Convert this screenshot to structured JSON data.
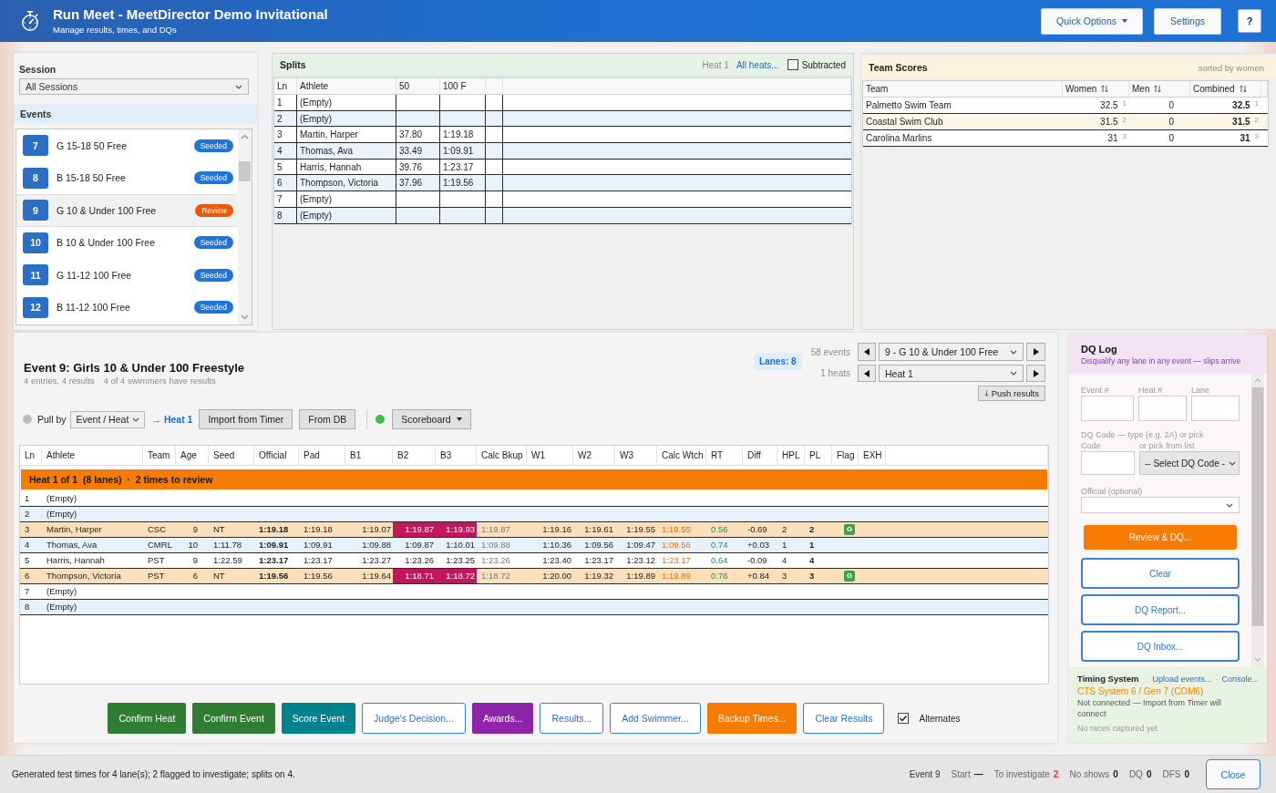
{
  "header": {
    "title": "Run Meet - MeetDirector Demo Invitational",
    "subtitle": "Manage results, times, and DQs",
    "buttons": [
      {
        "label": "Quick Options",
        "kind": "menu"
      },
      {
        "label": "Settings",
        "kind": "settings"
      },
      {
        "label": "?",
        "kind": "help"
      }
    ]
  },
  "session": {
    "label": "Session",
    "value": "All Sessions"
  },
  "events": {
    "title": "Events",
    "items": [
      {
        "number": "7",
        "name": "G 15-18 50 Free",
        "status": "Seeded",
        "color": "#1f74d6",
        "selected": false
      },
      {
        "number": "8",
        "name": "B 15-18 50 Free",
        "status": "Seeded",
        "color": "#1f74d6",
        "selected": false
      },
      {
        "number": "9",
        "name": "G 10 & Under 100 Free",
        "status": "Review",
        "color": "#e8590c",
        "selected": true
      },
      {
        "number": "10",
        "name": "B 10 & Under 100 Free",
        "status": "Seeded",
        "color": "#1f74d6",
        "selected": false
      },
      {
        "number": "11",
        "name": "G 11-12 100 Free",
        "status": "Seeded",
        "color": "#1f74d6",
        "selected": false
      },
      {
        "number": "12",
        "name": "B 11-12 100 Free",
        "status": "Seeded",
        "color": "#1f74d6",
        "selected": false
      }
    ]
  },
  "splits": {
    "title": "Splits",
    "heat": "Heat 1",
    "all_heats": "All heats...",
    "subtracted": {
      "label": "Subtracted",
      "checked": false
    },
    "columns": [
      "Ln",
      "Athlete",
      "50",
      "100 F"
    ],
    "rows": [
      {
        "lane": "1",
        "athlete": "(Empty)"
      },
      {
        "lane": "2",
        "athlete": "(Empty)"
      },
      {
        "lane": "3",
        "athlete": "Martin, Harper",
        "times": [
          "37.80",
          "1:19.18"
        ]
      },
      {
        "lane": "4",
        "athlete": "Thomas, Ava",
        "times": [
          "33.49",
          "1:09.91"
        ]
      },
      {
        "lane": "5",
        "athlete": "Harris, Hannah",
        "times": [
          "39.76",
          "1:23.17"
        ]
      },
      {
        "lane": "6",
        "athlete": "Thompson, Victoria",
        "times": [
          "37.96",
          "1:19.56"
        ]
      },
      {
        "lane": "7",
        "athlete": "(Empty)"
      },
      {
        "lane": "8",
        "athlete": "(Empty)"
      }
    ]
  },
  "team_scores": {
    "title": "Team Scores",
    "note": "sorted by women",
    "columns": [
      {
        "label": "Team",
        "sortable": false
      },
      {
        "label": "Women",
        "sortable": true
      },
      {
        "label": "Men",
        "sortable": true
      },
      {
        "label": "Combined",
        "sortable": true
      }
    ],
    "rows": [
      {
        "team": "Palmetto Swim Team",
        "women": "32.5",
        "women_rank": "1",
        "men": "0",
        "combined": "32.5",
        "combined_rank": "1"
      },
      {
        "team": "Coastal Swim Club",
        "women": "31.5",
        "women_rank": "2",
        "men": "0",
        "combined": "31.5",
        "combined_rank": "2"
      },
      {
        "team": "Carolina Marlins",
        "women": "31",
        "women_rank": "3",
        "men": "0",
        "combined": "31",
        "combined_rank": "3"
      }
    ]
  },
  "event": {
    "title": "Event 9: Girls 10 & Under 100 Freestyle",
    "summary": "4 entries, 4 results",
    "results_note": "4 of 4 swimmers have results",
    "lanes": "Lanes: 8",
    "event_count": "58 events",
    "event_select": "9 - G 10 & Under 100 Free",
    "heat_count": "1 heats",
    "heat_select": "Heat 1",
    "push_results": "Push results"
  },
  "toolbar": {
    "pull_indicator_on": false,
    "pull_label": "Pull by",
    "pull_value": "Event / Heat",
    "heat_link": "→ Heat 1",
    "buttons": [
      "Import from Timer",
      "From DB"
    ],
    "scoreboard": {
      "label": "Scoreboard",
      "indicator_on": true
    }
  },
  "results": {
    "columns": [
      "Ln",
      "Athlete",
      "Team",
      "Age",
      "Seed",
      "Official",
      "Pad",
      "B1",
      "B2",
      "B3",
      "Calc Bkup",
      "W1",
      "W2",
      "W3",
      "Calc Wtch",
      "RT",
      "Diff",
      "HPL",
      "PL",
      "Flag",
      "EXH"
    ],
    "banner": "Heat 1 of 1  (8 lanes)  ·  2 times to review",
    "rows": [
      {
        "lane": "1",
        "athlete": "(Empty)"
      },
      {
        "lane": "2",
        "athlete": "(Empty)"
      },
      {
        "lane": "3",
        "athlete": "Martin, Harper",
        "team": "CSC",
        "age": "9",
        "seed": "NT",
        "official": "1:19.18",
        "pad": "1:19.18",
        "backups": [
          {
            "time": "1:19.07",
            "outlier": false
          },
          {
            "time": "1:19.87",
            "outlier": true
          },
          {
            "time": "1:19.93",
            "outlier": true
          }
        ],
        "calc_backup": "1:19.87",
        "watches": [
          "1:19.16",
          "1:19.61",
          "1:19.55"
        ],
        "calc_watch": "1:19.55",
        "rt": "0.56",
        "diff": "-0.69",
        "hpl": "2",
        "pl": "2",
        "flag": "G",
        "investigate": true
      },
      {
        "lane": "4",
        "athlete": "Thomas, Ava",
        "team": "CMRL",
        "age": "10",
        "seed": "1:11.78",
        "official": "1:09.91",
        "pad": "1:09.91",
        "backups": [
          {
            "time": "1:09.88",
            "outlier": false
          },
          {
            "time": "1:09.87",
            "outlier": false
          },
          {
            "time": "1:10.01",
            "outlier": false
          }
        ],
        "calc_backup": "1:09.88",
        "watches": [
          "1:10.36",
          "1:09.56",
          "1:09.47"
        ],
        "calc_watch": "1:09.56",
        "rt": "0.74",
        "diff": "+0.03",
        "hpl": "1",
        "pl": "1",
        "investigate": false
      },
      {
        "lane": "5",
        "athlete": "Harris, Hannah",
        "team": "PST",
        "age": "9",
        "seed": "1:22.59",
        "official": "1:23.17",
        "pad": "1:23.17",
        "backups": [
          {
            "time": "1:23.27",
            "outlier": false
          },
          {
            "time": "1:23.26",
            "outlier": false
          },
          {
            "time": "1:23.25",
            "outlier": false
          }
        ],
        "calc_backup": "1:23.26",
        "watches": [
          "1:23.40",
          "1:23.17",
          "1:23.12"
        ],
        "calc_watch": "1:23.17",
        "rt": "0.64",
        "diff": "-0.09",
        "hpl": "4",
        "pl": "4",
        "investigate": false
      },
      {
        "lane": "6",
        "athlete": "Thompson, Victoria",
        "team": "PST",
        "age": "6",
        "seed": "NT",
        "official": "1:19.56",
        "pad": "1:19.56",
        "backups": [
          {
            "time": "1:19.64",
            "outlier": false
          },
          {
            "time": "1:18.71",
            "outlier": true
          },
          {
            "time": "1:18.72",
            "outlier": true
          }
        ],
        "calc_backup": "1:18.72",
        "watches": [
          "1:20.00",
          "1:19.32",
          "1:19.89"
        ],
        "calc_watch": "1:19.89",
        "rt": "0.76",
        "diff": "+0.84",
        "hpl": "3",
        "pl": "3",
        "flag": "G",
        "investigate": true
      },
      {
        "lane": "7",
        "athlete": "(Empty)"
      },
      {
        "lane": "8",
        "athlete": "(Empty)"
      }
    ]
  },
  "dq_log": {
    "title": "DQ Log",
    "subtitle": "Disqualify any lane in any event — slips arrive",
    "fields": [
      "Event #",
      "Heat #",
      "Lane"
    ],
    "code_hint": "DQ Code — type (e.g. 2A) or pick",
    "code_label": "Code",
    "pick_label": "or pick from list",
    "code_select": "-- Select DQ Code -",
    "official_label": "Official (optional)",
    "buttons": [
      {
        "label": "Review & DQ...",
        "kind": "primary"
      },
      {
        "label": "Clear",
        "kind": "outline"
      },
      {
        "label": "DQ Report...",
        "kind": "outline"
      },
      {
        "label": "DQ Inbox...",
        "kind": "outline"
      }
    ]
  },
  "timing_system": {
    "title": "Timing System",
    "links": [
      "Upload events...",
      "Console..."
    ],
    "separator": "·",
    "device": "CTS System 6 / Gen 7 (COM6)",
    "status": "Not connected — Import from Timer will connect",
    "note": "No races captured yet"
  },
  "actions": {
    "buttons": [
      {
        "label": "Confirm Heat",
        "kind": "filled",
        "color": "#2e7d32"
      },
      {
        "label": "Confirm Event",
        "kind": "filled",
        "color": "#2e7d32"
      },
      {
        "label": "Score Event",
        "kind": "filled",
        "color": "#00838f"
      },
      {
        "label": "Judge's Decision...",
        "kind": "outline"
      },
      {
        "label": "Awards...",
        "kind": "filled",
        "color": "#8e24aa"
      },
      {
        "label": "Results...",
        "kind": "outline"
      },
      {
        "label": "Add Swimmer...",
        "kind": "outline"
      },
      {
        "label": "Backup Times...",
        "kind": "filled",
        "color": "#f57c00"
      },
      {
        "label": "Clear Results",
        "kind": "outline"
      }
    ],
    "alternates": {
      "label": "Alternates",
      "checked": true
    }
  },
  "status_bar": {
    "message": "Generated test times for 4 lane(s); 2 flagged to investigate; splits on 4.",
    "event": "Event 9",
    "stats": [
      {
        "label": "Start",
        "value": "—",
        "alert": false
      },
      {
        "label": "To investigate",
        "value": "2",
        "alert": true
      },
      {
        "label": "No shows",
        "value": "0",
        "alert": false
      },
      {
        "label": "DQ",
        "value": "0",
        "alert": false
      },
      {
        "label": "DFS",
        "value": "0",
        "alert": false
      }
    ],
    "close": "Close"
  }
}
